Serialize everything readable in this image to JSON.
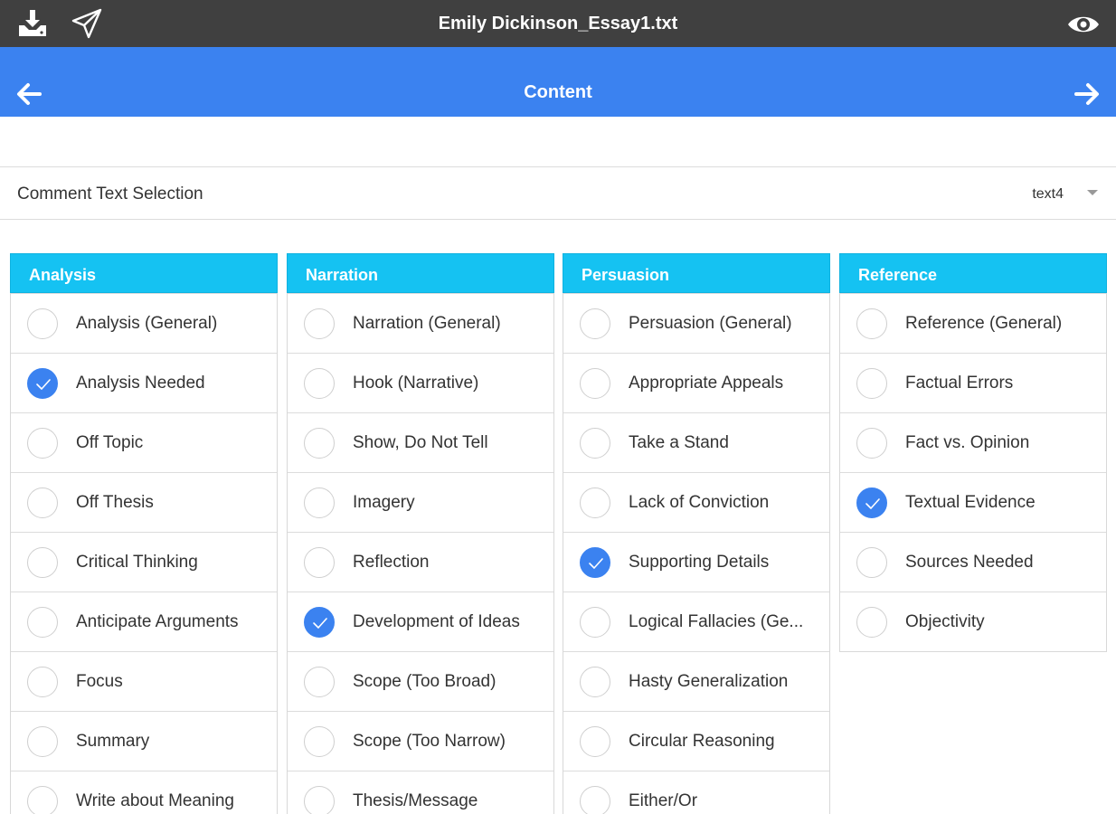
{
  "app": {
    "file_title": "Emily Dickinson_Essay1.txt",
    "toolbar_icons": [
      "download-icon",
      "send-icon",
      "eye-icon"
    ]
  },
  "nav": {
    "title": "Content",
    "back_icon": "arrow-left-icon",
    "forward_icon": "arrow-right-icon"
  },
  "comment_selection": {
    "label": "Comment Text Selection",
    "value": "text4"
  },
  "colors": {
    "topbar": "#404040",
    "navbar": "#3b82f0",
    "column_header": "#15c2f2",
    "checked": "#3b82f0"
  },
  "columns": [
    {
      "title": "Analysis",
      "items": [
        {
          "label": "Analysis (General)",
          "checked": false
        },
        {
          "label": "Analysis Needed",
          "checked": true
        },
        {
          "label": "Off Topic",
          "checked": false
        },
        {
          "label": "Off Thesis",
          "checked": false
        },
        {
          "label": "Critical Thinking",
          "checked": false
        },
        {
          "label": "Anticipate Arguments",
          "checked": false
        },
        {
          "label": "Focus",
          "checked": false
        },
        {
          "label": "Summary",
          "checked": false
        },
        {
          "label": "Write about Meaning",
          "checked": false
        }
      ]
    },
    {
      "title": "Narration",
      "items": [
        {
          "label": "Narration (General)",
          "checked": false
        },
        {
          "label": "Hook (Narrative)",
          "checked": false
        },
        {
          "label": "Show, Do Not Tell",
          "checked": false
        },
        {
          "label": "Imagery",
          "checked": false
        },
        {
          "label": "Reflection",
          "checked": false
        },
        {
          "label": "Development of Ideas",
          "checked": true
        },
        {
          "label": "Scope (Too Broad)",
          "checked": false
        },
        {
          "label": "Scope (Too Narrow)",
          "checked": false
        },
        {
          "label": "Thesis/Message",
          "checked": false
        }
      ]
    },
    {
      "title": "Persuasion",
      "items": [
        {
          "label": "Persuasion (General)",
          "checked": false
        },
        {
          "label": "Appropriate Appeals",
          "checked": false
        },
        {
          "label": "Take a Stand",
          "checked": false
        },
        {
          "label": "Lack of Conviction",
          "checked": false
        },
        {
          "label": "Supporting Details",
          "checked": true
        },
        {
          "label": "Logical Fallacies (Ge...",
          "checked": false
        },
        {
          "label": "Hasty Generalization",
          "checked": false
        },
        {
          "label": "Circular Reasoning",
          "checked": false
        },
        {
          "label": "Either/Or",
          "checked": false
        }
      ]
    },
    {
      "title": "Reference",
      "items": [
        {
          "label": "Reference (General)",
          "checked": false
        },
        {
          "label": "Factual Errors",
          "checked": false
        },
        {
          "label": "Fact vs. Opinion",
          "checked": false
        },
        {
          "label": "Textual Evidence",
          "checked": true
        },
        {
          "label": "Sources Needed",
          "checked": false
        },
        {
          "label": "Objectivity",
          "checked": false
        }
      ]
    }
  ]
}
